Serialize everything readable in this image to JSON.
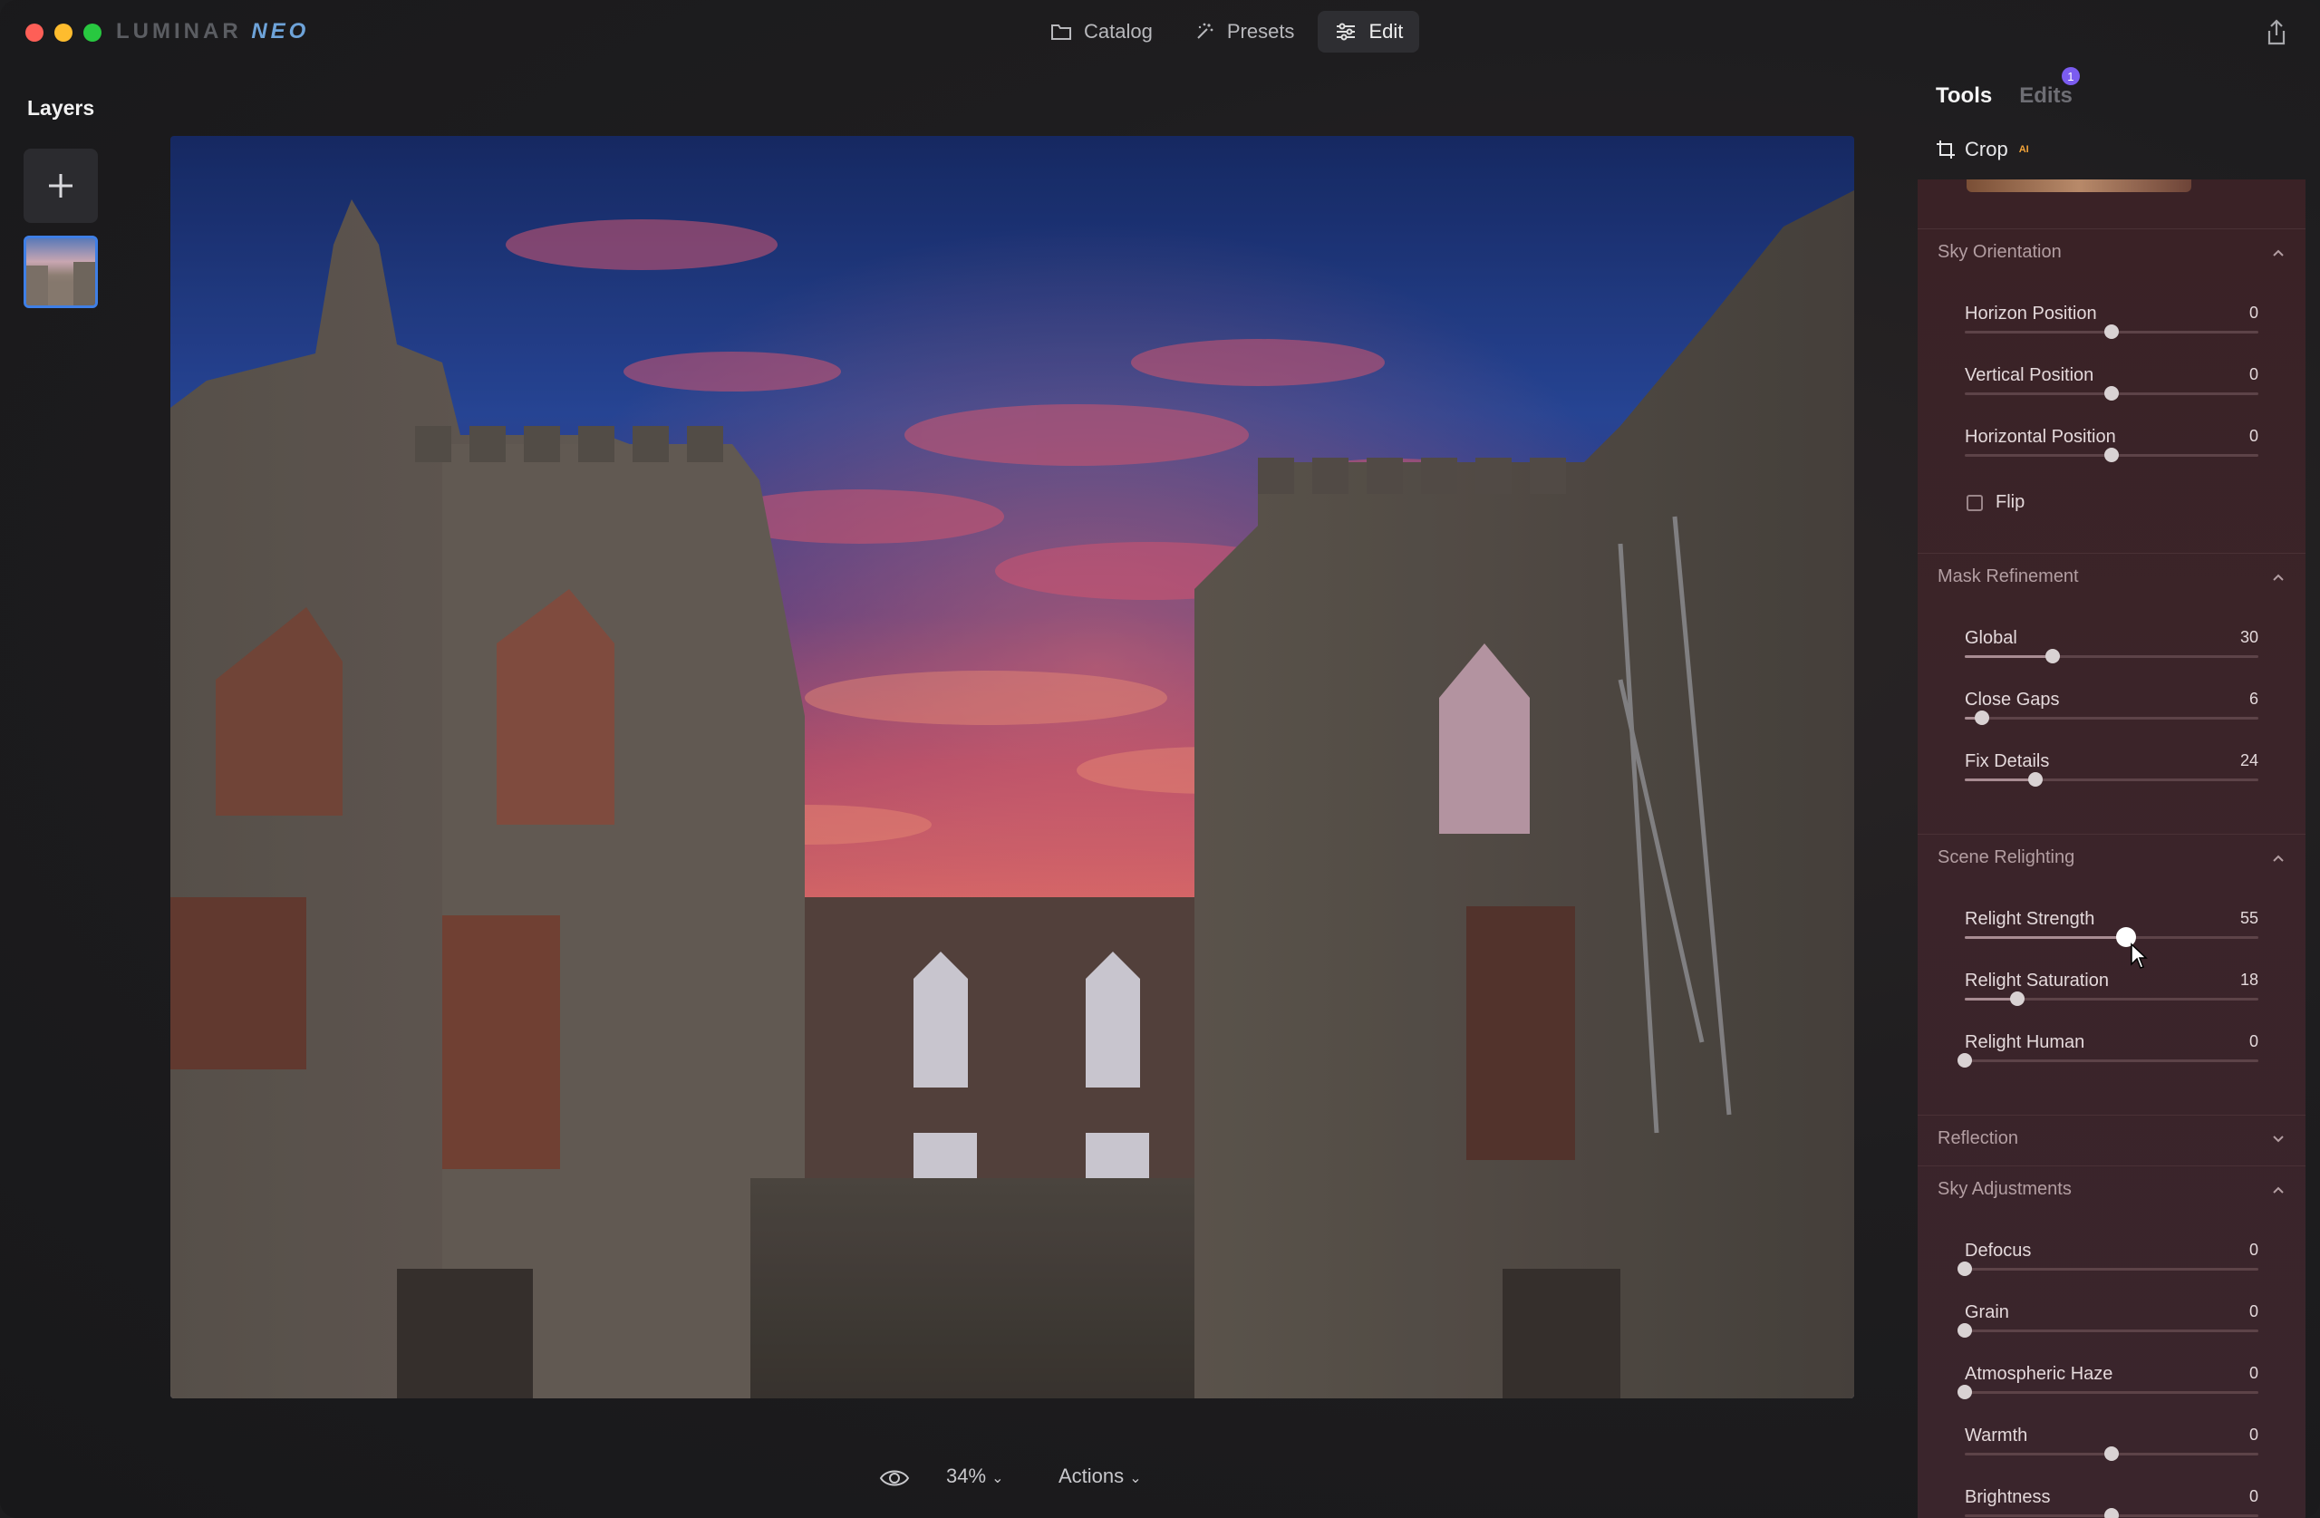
{
  "app": {
    "brand_main": "LUMINAR",
    "brand_accent": "NEO"
  },
  "nav": {
    "catalog": "Catalog",
    "presets": "Presets",
    "edit": "Edit"
  },
  "layers": {
    "title": "Layers"
  },
  "bottom": {
    "zoom": "34%",
    "actions": "Actions"
  },
  "panel": {
    "tab_tools": "Tools",
    "tab_edits": "Edits",
    "edits_badge": "1",
    "crop": "Crop",
    "crop_ai": "AI",
    "sections": {
      "sky_orientation": {
        "title": "Sky Orientation",
        "horizon": {
          "label": "Horizon Position",
          "value": "0",
          "pos": 0.5
        },
        "vertical": {
          "label": "Vertical Position",
          "value": "0",
          "pos": 0.5
        },
        "horizontal": {
          "label": "Horizontal Position",
          "value": "0",
          "pos": 0.5
        },
        "flip": "Flip"
      },
      "mask_refinement": {
        "title": "Mask Refinement",
        "global": {
          "label": "Global",
          "value": "30",
          "pos": 0.3
        },
        "close_gaps": {
          "label": "Close Gaps",
          "value": "6",
          "pos": 0.06
        },
        "fix_details": {
          "label": "Fix Details",
          "value": "24",
          "pos": 0.24
        }
      },
      "scene_relighting": {
        "title": "Scene Relighting",
        "strength": {
          "label": "Relight Strength",
          "value": "55",
          "pos": 0.55
        },
        "saturation": {
          "label": "Relight Saturation",
          "value": "18",
          "pos": 0.18
        },
        "human": {
          "label": "Relight Human",
          "value": "0",
          "pos": 0.0
        }
      },
      "reflection": {
        "title": "Reflection"
      },
      "sky_adjustments": {
        "title": "Sky Adjustments",
        "defocus": {
          "label": "Defocus",
          "value": "0",
          "pos": 0.0
        },
        "grain": {
          "label": "Grain",
          "value": "0",
          "pos": 0.0
        },
        "haze": {
          "label": "Atmospheric Haze",
          "value": "0",
          "pos": 0.0
        },
        "warmth": {
          "label": "Warmth",
          "value": "0",
          "pos": 0.5
        },
        "brightness": {
          "label": "Brightness",
          "value": "0",
          "pos": 0.5
        }
      }
    }
  },
  "colors": {
    "accent": "#3f7fe6",
    "badge": "#7b5cf0",
    "panel_bg": "#3a2226"
  }
}
